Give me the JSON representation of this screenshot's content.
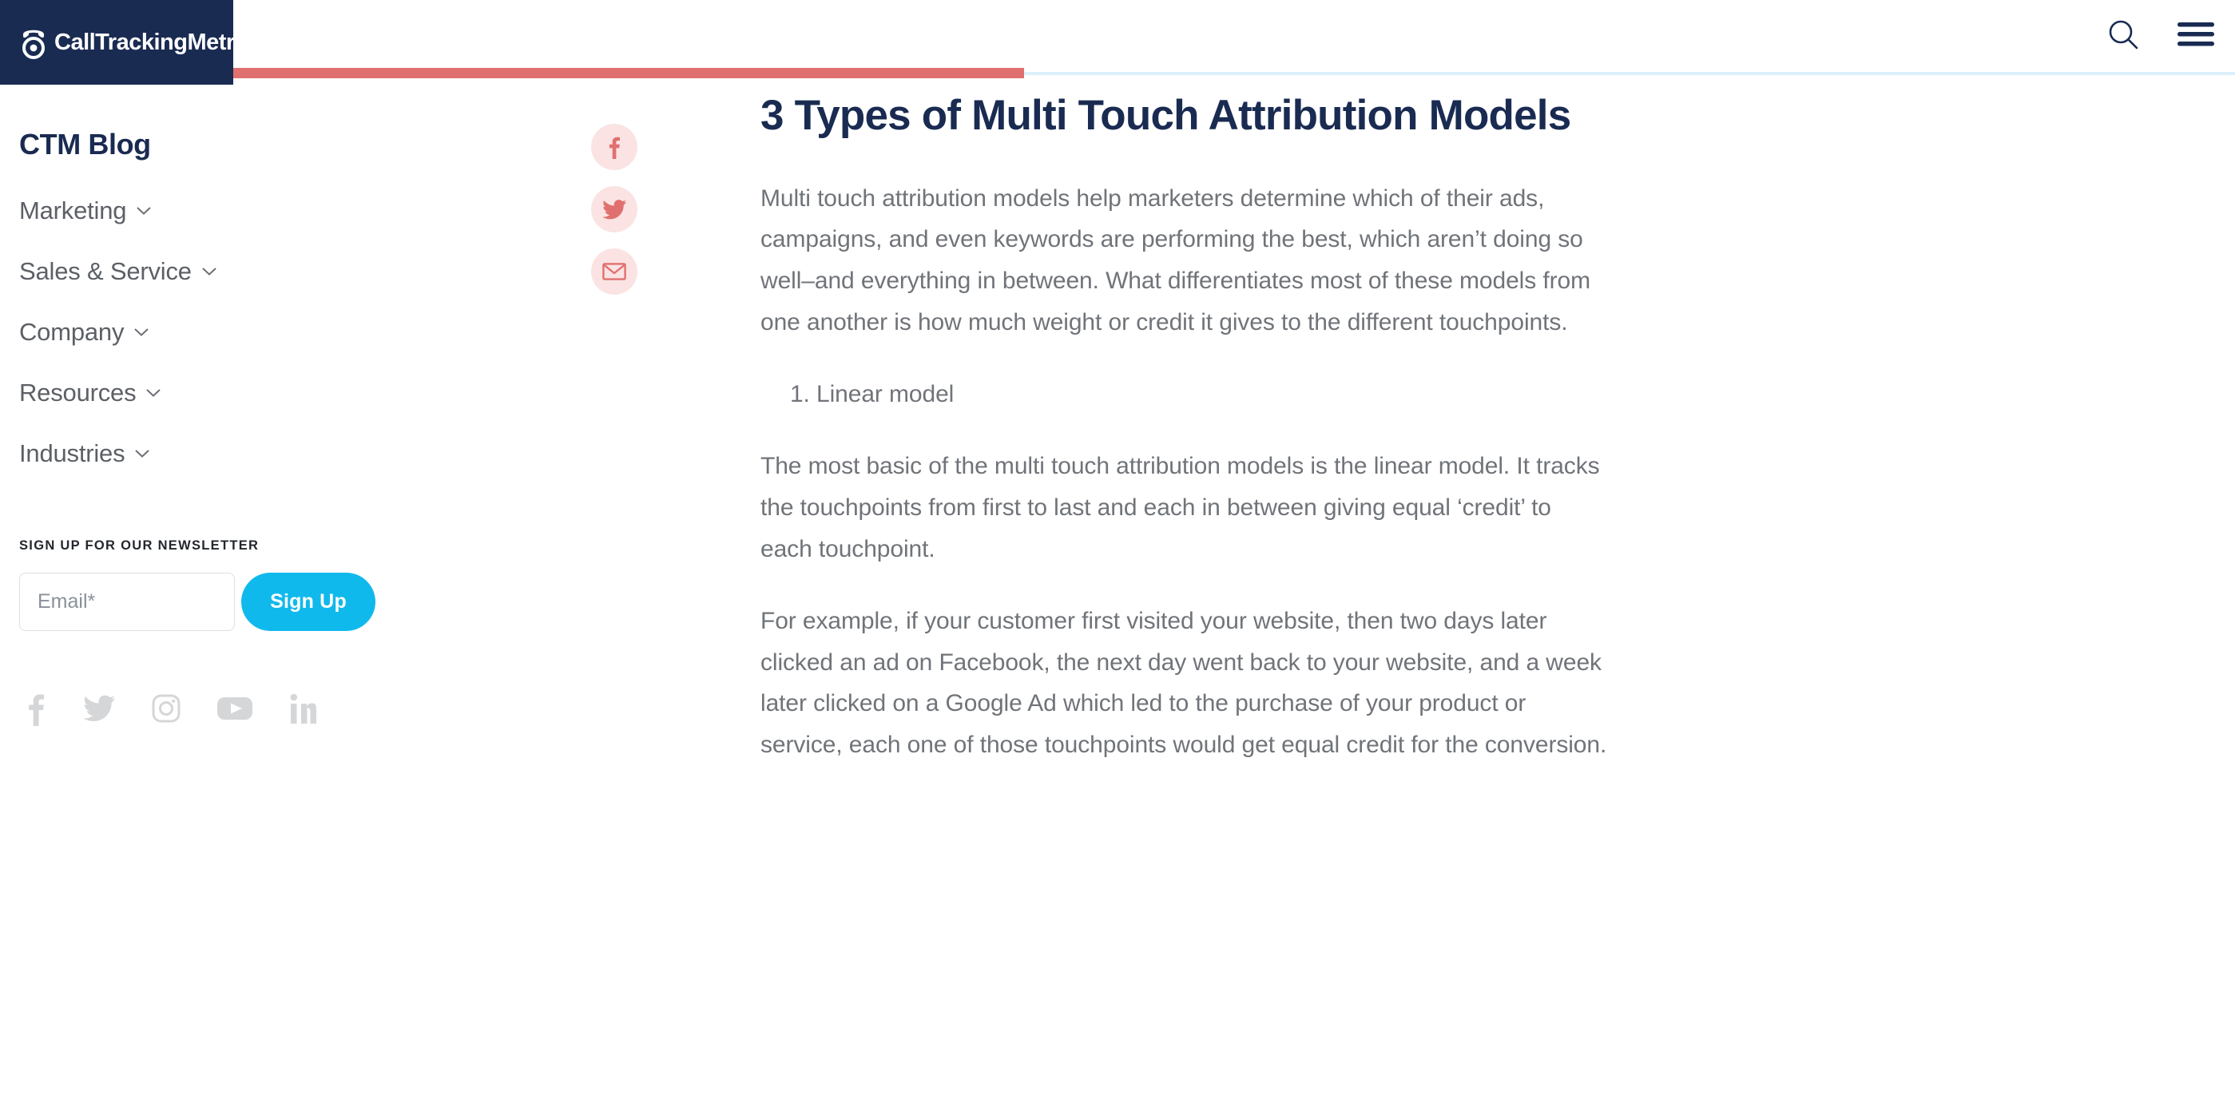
{
  "header": {
    "brand_name": "CallTrackingMetrics",
    "logo_icon": "phone-dial-logo-icon",
    "search_icon": "search-icon",
    "menu_icon": "hamburger-menu-icon",
    "navy": "#1a2b52",
    "accent_red": "#e0706f",
    "progress_track": "#dcf0fb"
  },
  "sidebar": {
    "title": "CTM Blog",
    "nav_items": [
      {
        "label": "Marketing",
        "icon": "chevron-down-icon"
      },
      {
        "label": "Sales & Service",
        "icon": "chevron-down-icon"
      },
      {
        "label": "Company",
        "icon": "chevron-down-icon"
      },
      {
        "label": "Resources",
        "icon": "chevron-down-icon"
      },
      {
        "label": "Industries",
        "icon": "chevron-down-icon"
      }
    ],
    "newsletter": {
      "heading": "SIGN UP FOR OUR NEWSLETTER",
      "email_placeholder": "Email*",
      "email_value": "",
      "submit_label": "Sign Up",
      "button_color": "#10b9ec"
    },
    "social_links": [
      {
        "name": "facebook-icon"
      },
      {
        "name": "twitter-icon"
      },
      {
        "name": "instagram-icon"
      },
      {
        "name": "youtube-icon"
      },
      {
        "name": "linkedin-icon"
      }
    ]
  },
  "share": {
    "buttons": [
      {
        "name": "share-facebook-icon"
      },
      {
        "name": "share-twitter-icon"
      },
      {
        "name": "share-email-icon"
      }
    ],
    "bubble_color": "#fbe3e3",
    "icon_color": "#e0706f"
  },
  "article": {
    "title": "3 Types of Multi Touch Attribution Models",
    "paragraph_1": "Multi touch attribution models help marketers determine which of their ads, campaigns, and even keywords are performing the best, which aren’t doing so well–and everything in between. What differentiates most of these models from one another is how much weight or credit it gives to the different touchpoints.",
    "list_item_1": "Linear model",
    "paragraph_2": "The most basic of the multi touch attribution models is the linear model. It tracks the touchpoints from first to last and each in between giving equal ‘credit’ to each touchpoint.",
    "paragraph_3": "For example, if your customer first visited your website, then two days later clicked an ad on Facebook, the next day went back to your website, and a week later clicked on a Google Ad which led to the purchase of your product or service, each one of those touchpoints would get equal credit for the conversion."
  }
}
